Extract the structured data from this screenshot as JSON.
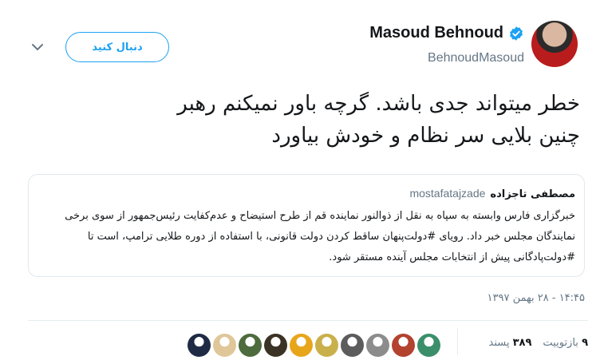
{
  "user": {
    "display_name": "Masoud Behnoud",
    "handle": "BehnoudMasoud",
    "verified": true
  },
  "follow_button_label": "دنبال کنید",
  "tweet_text": "خطر میتواند جدی باشد.  گرچه باور نمیکنم رهبر\nچنین بلایی سر نظام و خودش بیاورد",
  "quote": {
    "name": "مصطفی تاجزاده",
    "handle": "mostafatajzade",
    "text": "خبرگزاری فارس وابسته به سپاه به نقل از ذوالنور نماینده قم از طرح استیضاح و عدم‌کفایت رئیس‌جمهور از سوی برخی نمایندگان مجلس خبر داد. رویای #دولت‌پنهان ساقط کردن دولت قانونی، با استفاده از دوره طلایی ترامپ، است تا #دولت‌پادگانی پیش از انتخابات مجلس آینده مستقر شود."
  },
  "timestamp": "۱۴:۴۵ - ۲۸ بهمن ۱۳۹۷",
  "stats": {
    "retweets_count": "۹",
    "retweets_label": "بازتوییت",
    "likes_count": "۳۸۹",
    "likes_label": "پسند"
  },
  "liker_avatars": [
    {
      "color": "#3a8f6a"
    },
    {
      "color": "#b3422f"
    },
    {
      "color": "#8c8c8c"
    },
    {
      "color": "#5c5c5c"
    },
    {
      "color": "#c9b04a"
    },
    {
      "color": "#e7a61a"
    },
    {
      "color": "#3b3226"
    },
    {
      "color": "#4d6b3c"
    },
    {
      "color": "#e0c79a"
    },
    {
      "color": "#1f2a44"
    }
  ],
  "colors": {
    "accent": "#1da1f2",
    "muted": "#657786",
    "border": "#e1e8ed"
  }
}
